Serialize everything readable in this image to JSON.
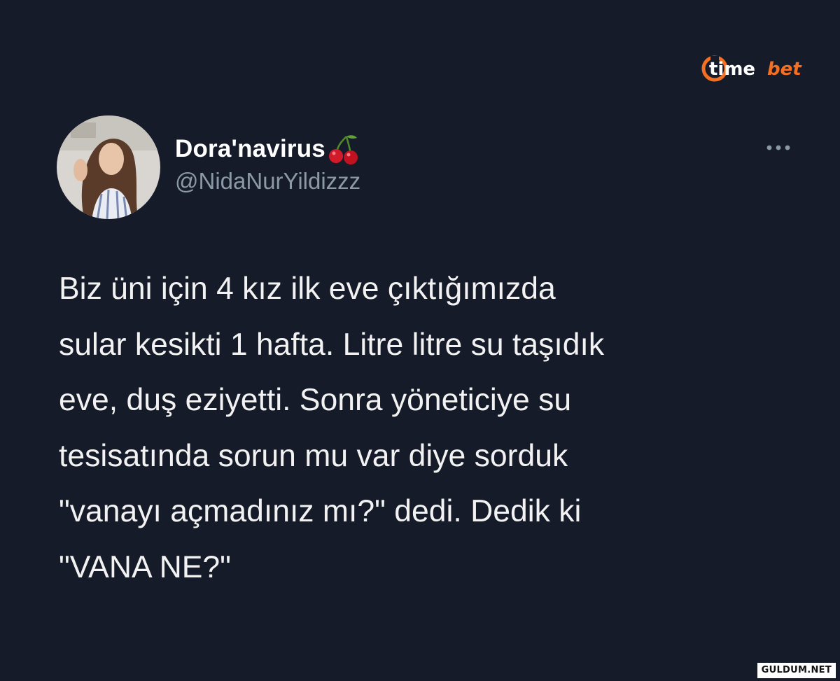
{
  "brand": {
    "logo_text_primary": "time",
    "logo_text_accent": "bet",
    "accent_color": "#f36f21"
  },
  "tweet": {
    "author": {
      "display_name": "Dora'navirus",
      "handle": "@NidaNurYildizzz",
      "name_emoji": "cherry-icon"
    },
    "more_menu_icon": "more-horizontal-icon",
    "text_lines": [
      "Biz üni için 4 kız ilk eve çıktığımızda",
      "sular kesikti 1 hafta. Litre litre su taşıdık",
      "eve, duş eziyetti. Sonra yöneticiye su",
      "tesisatında sorun mu var diye sorduk",
      "\"vanayı açmadınız mı?\" dedi. Dedik ki",
      "\"VANA NE?\""
    ]
  },
  "watermark": {
    "text": "GULDUM.NET"
  },
  "colors": {
    "background": "#161b29",
    "primary_text": "#ffffff",
    "secondary_text": "#8b98a5"
  }
}
